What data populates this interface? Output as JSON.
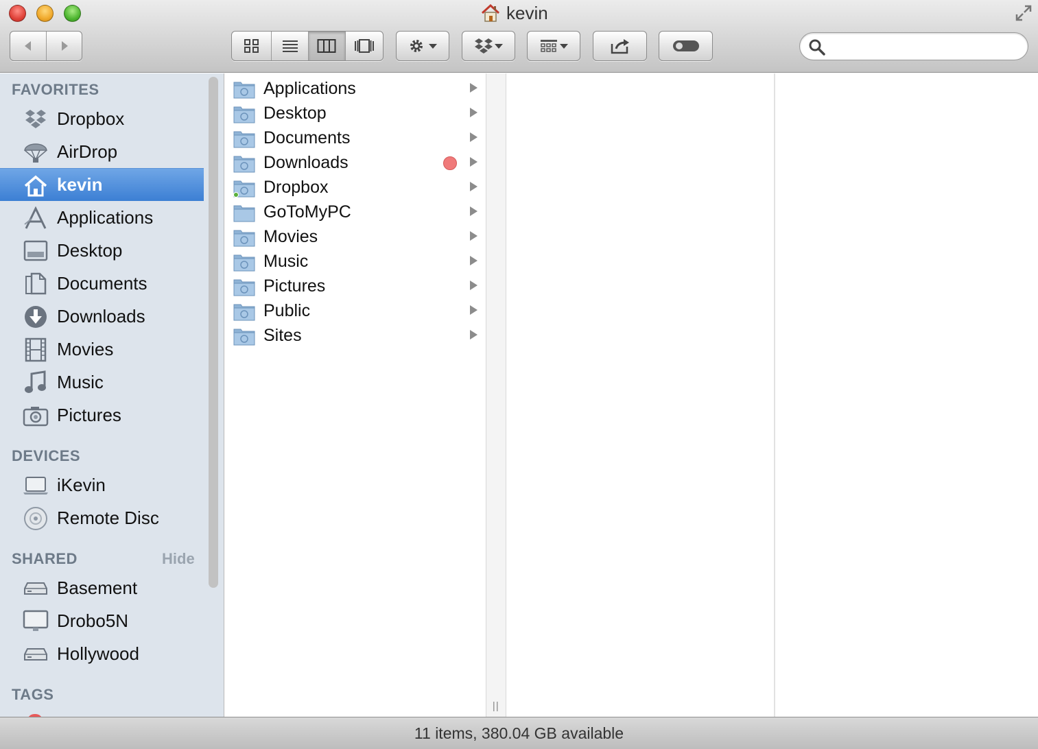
{
  "window": {
    "title": "kevin"
  },
  "toolbar": {
    "back_icon": "back-arrow-icon",
    "forward_icon": "forward-arrow-icon",
    "view_modes": [
      "icon",
      "list",
      "column",
      "coverflow"
    ],
    "active_view": "column",
    "search": {
      "placeholder": "",
      "value": ""
    }
  },
  "sidebar": {
    "favorites_heading": "FAVORITES",
    "favorites": [
      {
        "label": "Dropbox",
        "icon": "dropbox-icon"
      },
      {
        "label": "AirDrop",
        "icon": "airdrop-icon"
      },
      {
        "label": "kevin",
        "icon": "home-icon",
        "selected": true
      },
      {
        "label": "Applications",
        "icon": "applications-icon"
      },
      {
        "label": "Desktop",
        "icon": "desktop-icon"
      },
      {
        "label": "Documents",
        "icon": "documents-icon"
      },
      {
        "label": "Downloads",
        "icon": "downloads-icon"
      },
      {
        "label": "Movies",
        "icon": "movies-icon"
      },
      {
        "label": "Music",
        "icon": "music-icon"
      },
      {
        "label": "Pictures",
        "icon": "pictures-icon"
      }
    ],
    "devices_heading": "DEVICES",
    "devices": [
      {
        "label": "iKevin",
        "icon": "laptop-icon"
      },
      {
        "label": "Remote Disc",
        "icon": "disc-icon"
      }
    ],
    "shared_heading": "SHARED",
    "shared_hide": "Hide",
    "shared": [
      {
        "label": "Basement",
        "icon": "server-icon"
      },
      {
        "label": "Drobo5N",
        "icon": "display-icon"
      },
      {
        "label": "Hollywood",
        "icon": "server-icon"
      }
    ],
    "tags_heading": "TAGS"
  },
  "column1": {
    "items": [
      {
        "name": "Applications",
        "icon": "applications-folder-icon"
      },
      {
        "name": "Desktop",
        "icon": "desktop-folder-icon"
      },
      {
        "name": "Documents",
        "icon": "documents-folder-icon"
      },
      {
        "name": "Downloads",
        "icon": "downloads-folder-icon",
        "tag_color": "#f07a7a"
      },
      {
        "name": "Dropbox",
        "icon": "dropbox-folder-icon"
      },
      {
        "name": "GoToMyPC",
        "icon": "folder-icon"
      },
      {
        "name": "Movies",
        "icon": "movies-folder-icon"
      },
      {
        "name": "Music",
        "icon": "music-folder-icon"
      },
      {
        "name": "Pictures",
        "icon": "pictures-folder-icon"
      },
      {
        "name": "Public",
        "icon": "public-folder-icon"
      },
      {
        "name": "Sites",
        "icon": "sites-folder-icon"
      }
    ]
  },
  "status": {
    "text": "11 items, 380.04 GB available"
  },
  "colors": {
    "selection": "#3c7fd4",
    "sidebar_bg": "#dde4ec",
    "tag_red": "#f07a7a"
  }
}
